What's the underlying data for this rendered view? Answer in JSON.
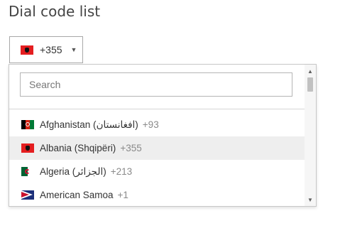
{
  "title": "Dial code list",
  "selector": {
    "flag_icon": "albania-flag-icon",
    "value": "+355",
    "caret": "▼"
  },
  "dropdown": {
    "search_placeholder": "Search",
    "items": [
      {
        "name": "Afghanistan (افغانستان)",
        "dial": "+93",
        "flag": "afghanistan-flag-icon",
        "selected": false
      },
      {
        "name": "Albania (Shqipëri)",
        "dial": "+355",
        "flag": "albania-flag-icon",
        "selected": true
      },
      {
        "name": "Algeria (الجزائر)",
        "dial": "+213",
        "flag": "algeria-flag-icon",
        "selected": false
      },
      {
        "name": "American Samoa",
        "dial": "+1",
        "flag": "american-samoa-flag-icon",
        "selected": false
      }
    ],
    "scroll_up": "▲",
    "scroll_down": "▼"
  }
}
